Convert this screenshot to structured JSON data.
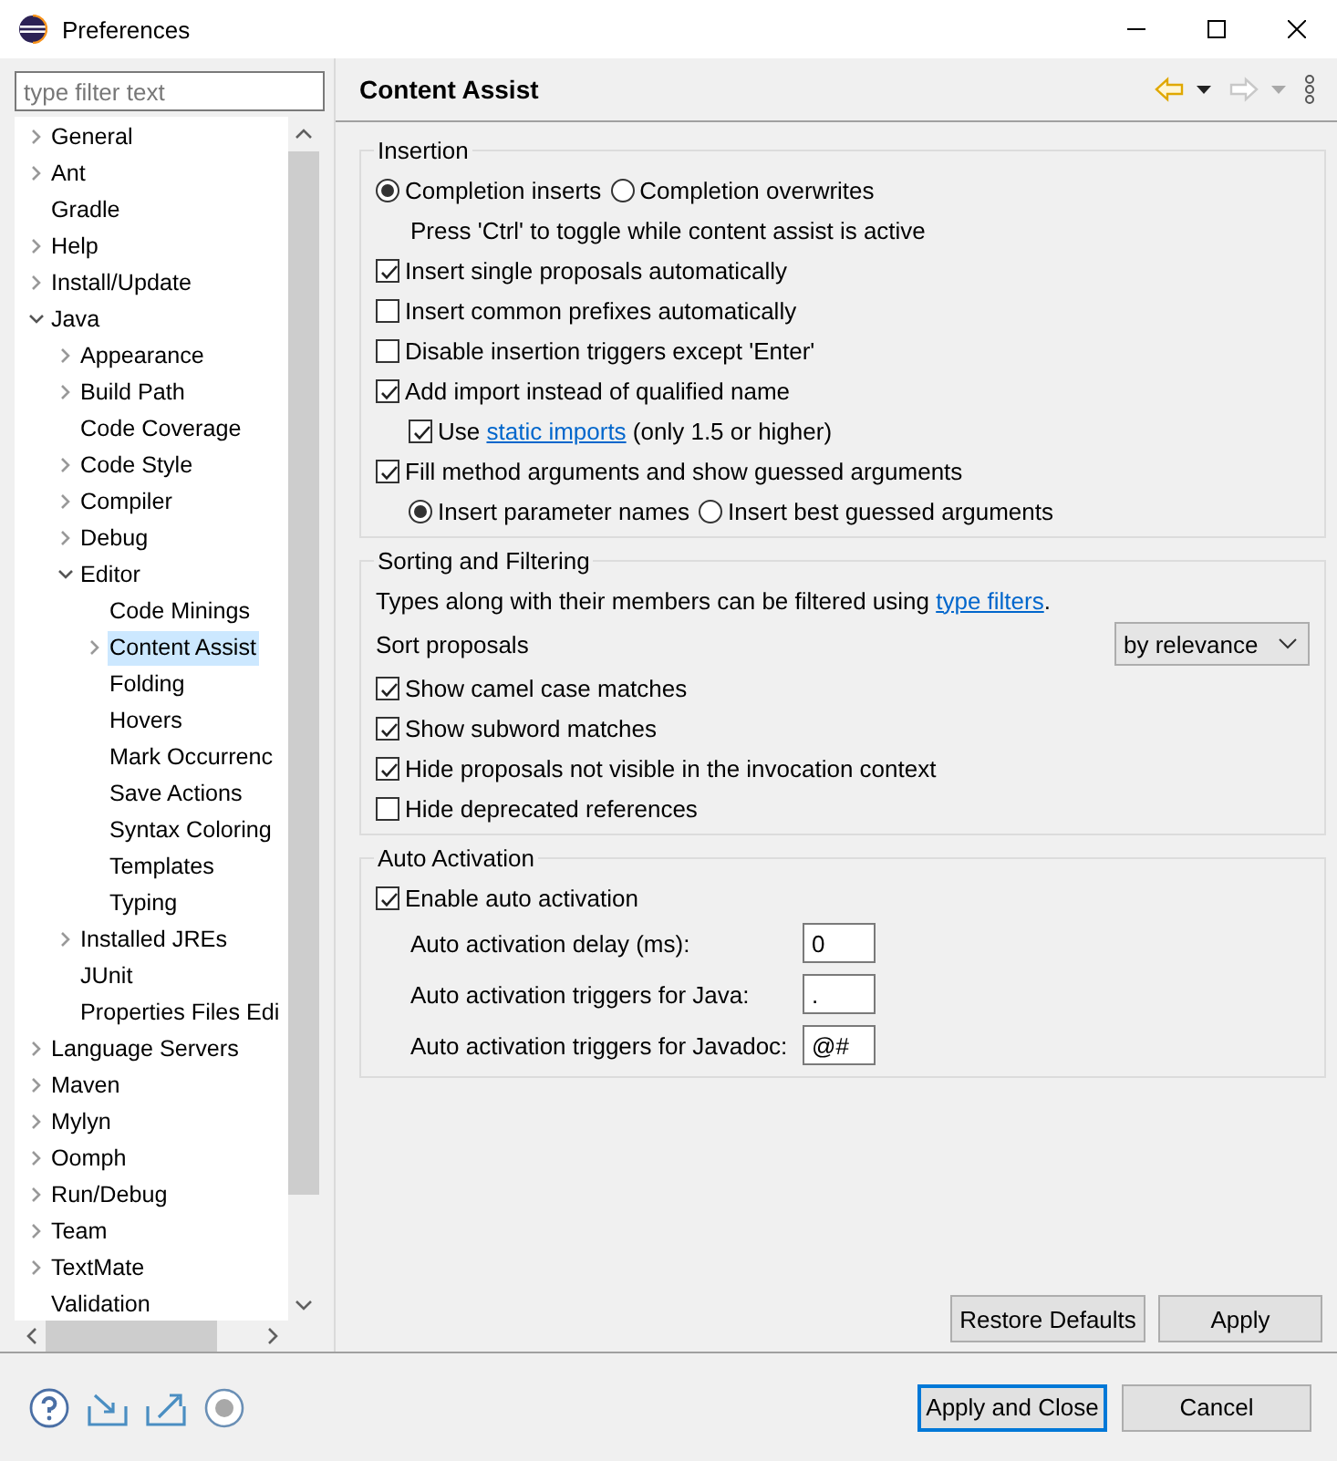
{
  "window": {
    "title": "Preferences"
  },
  "filter": {
    "placeholder": "type filter text"
  },
  "tree": [
    {
      "label": "General",
      "expanded": false,
      "selected": false
    },
    {
      "label": "Ant",
      "expanded": false,
      "selected": false
    },
    {
      "label": "Gradle",
      "selected": false
    },
    {
      "label": "Help",
      "expanded": false,
      "selected": false
    },
    {
      "label": "Install/Update",
      "expanded": false,
      "selected": false
    },
    {
      "label": "Java",
      "expanded": true,
      "selected": false,
      "children": [
        {
          "label": "Appearance",
          "expanded": false,
          "selected": false
        },
        {
          "label": "Build Path",
          "expanded": false,
          "selected": false
        },
        {
          "label": "Code Coverage",
          "selected": false
        },
        {
          "label": "Code Style",
          "expanded": false,
          "selected": false
        },
        {
          "label": "Compiler",
          "expanded": false,
          "selected": false
        },
        {
          "label": "Debug",
          "expanded": false,
          "selected": false
        },
        {
          "label": "Editor",
          "expanded": true,
          "selected": false,
          "children": [
            {
              "label": "Code Minings",
              "selected": false
            },
            {
              "label": "Content Assist",
              "expanded": false,
              "selected": true
            },
            {
              "label": "Folding",
              "selected": false
            },
            {
              "label": "Hovers",
              "selected": false
            },
            {
              "label": "Mark Occurrenc",
              "selected": false
            },
            {
              "label": "Save Actions",
              "selected": false
            },
            {
              "label": "Syntax Coloring",
              "selected": false
            },
            {
              "label": "Templates",
              "selected": false
            },
            {
              "label": "Typing",
              "selected": false
            }
          ]
        },
        {
          "label": "Installed JREs",
          "expanded": false,
          "selected": false
        },
        {
          "label": "JUnit",
          "selected": false
        },
        {
          "label": "Properties Files Edi",
          "selected": false
        }
      ]
    },
    {
      "label": "Language Servers",
      "expanded": false,
      "selected": false
    },
    {
      "label": "Maven",
      "expanded": false,
      "selected": false
    },
    {
      "label": "Mylyn",
      "expanded": false,
      "selected": false
    },
    {
      "label": "Oomph",
      "expanded": false,
      "selected": false
    },
    {
      "label": "Run/Debug",
      "expanded": false,
      "selected": false
    },
    {
      "label": "Team",
      "expanded": false,
      "selected": false
    },
    {
      "label": "TextMate",
      "expanded": false,
      "selected": false
    },
    {
      "label": "Validation",
      "selected": false
    }
  ],
  "page": {
    "title": "Content Assist",
    "nav": [
      {
        "kind": "back",
        "disabled": false
      },
      {
        "kind": "forward",
        "disabled": true
      }
    ],
    "groups": [
      {
        "title": "Insertion",
        "items": [
          {
            "kind": "radios",
            "options": [
              {
                "label": "Completion inserts",
                "selected": true
              },
              {
                "label": "Completion overwrites",
                "selected": false
              }
            ]
          },
          {
            "kind": "note",
            "text": "Press 'Ctrl' to toggle while content assist is active"
          },
          {
            "kind": "check",
            "label": "Insert single proposals automatically",
            "checked": true
          },
          {
            "kind": "check",
            "label": "Insert common prefixes automatically",
            "checked": false
          },
          {
            "kind": "check",
            "label": "Disable insertion triggers except 'Enter'",
            "checked": false
          },
          {
            "kind": "check",
            "label": "Add import instead of qualified name",
            "checked": true,
            "children": [
              {
                "kind": "check",
                "label": "Use ",
                "link": "static imports",
                "suffix": " (only 1.5 or higher)",
                "checked": true
              }
            ]
          },
          {
            "kind": "check",
            "label": "Fill method arguments and show guessed arguments",
            "checked": true,
            "children": [
              {
                "kind": "radios",
                "options": [
                  {
                    "label": "Insert parameter names",
                    "selected": true
                  },
                  {
                    "label": "Insert best guessed arguments",
                    "selected": false
                  }
                ]
              }
            ]
          }
        ]
      },
      {
        "title": "Sorting and Filtering",
        "items": [
          {
            "kind": "link-note",
            "text": "Types along with their members can be filtered using ",
            "link": "type filters",
            "suffix": "."
          },
          {
            "kind": "select",
            "label": "Sort proposals",
            "value": "by relevance"
          },
          {
            "kind": "check",
            "label": "Show camel case matches",
            "checked": true
          },
          {
            "kind": "check",
            "label": "Show subword matches",
            "checked": true
          },
          {
            "kind": "check",
            "label": "Hide proposals not visible in the invocation context",
            "checked": true
          },
          {
            "kind": "check",
            "label": "Hide deprecated references",
            "checked": false
          }
        ]
      },
      {
        "title": "Auto Activation",
        "items": [
          {
            "kind": "check",
            "label": "Enable auto activation",
            "checked": true
          },
          {
            "kind": "field",
            "label": "Auto activation delay (ms):",
            "value": "0"
          },
          {
            "kind": "field",
            "label": "Auto activation triggers for Java:",
            "value": "."
          },
          {
            "kind": "field",
            "label": "Auto activation triggers for Javadoc:",
            "value": "@#"
          }
        ]
      }
    ],
    "buttons": [
      "Restore Defaults",
      "Apply"
    ]
  },
  "footer": {
    "buttons": [
      {
        "label": "Apply and Close",
        "default": true
      },
      {
        "label": "Cancel",
        "default": false
      }
    ]
  }
}
